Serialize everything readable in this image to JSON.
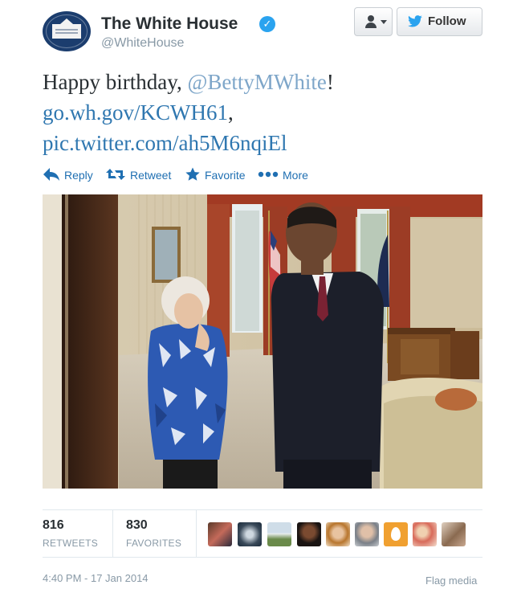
{
  "header": {
    "name": "The White House",
    "handle": "@WhiteHouse",
    "follow_label": "Follow"
  },
  "tweet": {
    "line1_prefix": "Happy birthday, ",
    "mention": "@BettyMWhite",
    "line1_suffix": "!",
    "link1": "go.wh.gov/KCWH61",
    "link1_suffix": ",",
    "link2": "pic.twitter.com/ah5M6nqiEl"
  },
  "actions": {
    "reply": "Reply",
    "retweet": "Retweet",
    "favorite": "Favorite",
    "more": "More"
  },
  "stats": {
    "retweets_count": "816",
    "retweets_label": "RETWEETS",
    "favorites_count": "830",
    "favorites_label": "FAVORITES"
  },
  "footer": {
    "timestamp": "4:40 PM - 17 Jan 2014",
    "flag_media": "Flag media"
  },
  "colors": {
    "link": "#2f77b0",
    "verified": "#2aa3ef",
    "muted": "#8899a6"
  }
}
